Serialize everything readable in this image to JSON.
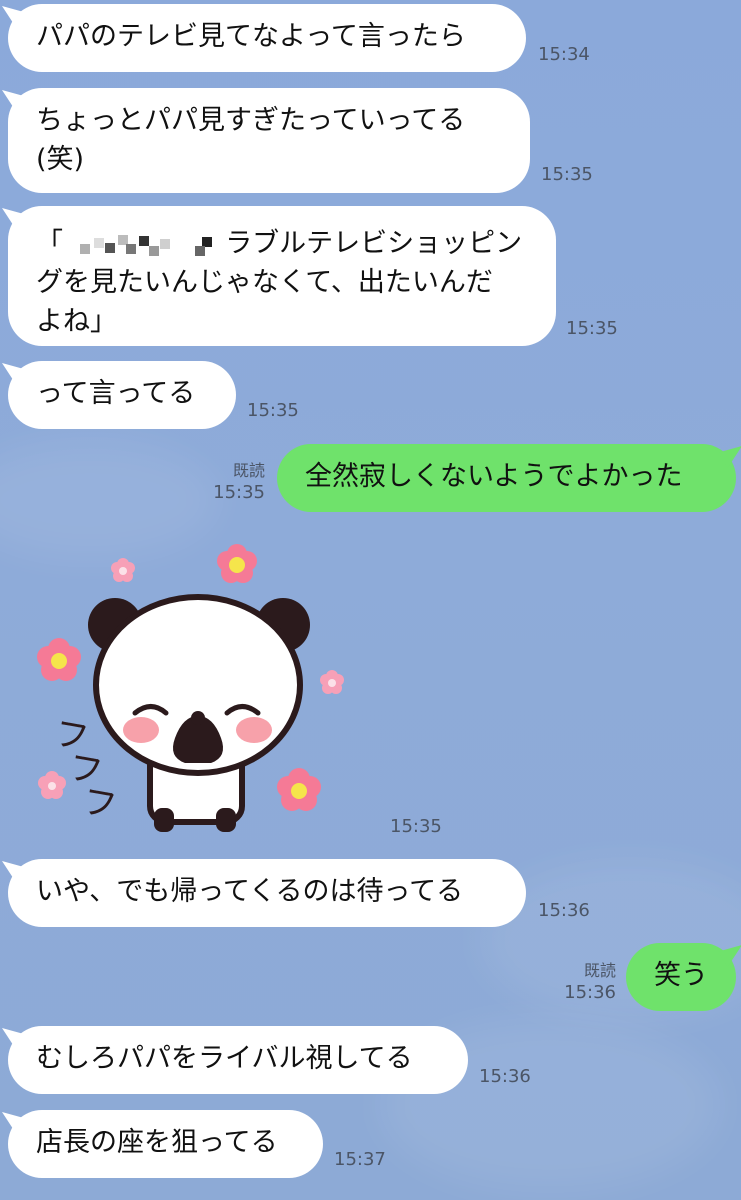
{
  "messages": [
    {
      "text": "パパのテレビ見てなよって言ったら",
      "time": "15:34"
    },
    {
      "text_line1": "ちょっとパパ見すぎたっていってる",
      "text_line2": "(笑)",
      "time": "15:35"
    },
    {
      "text_line1_prefix": "「",
      "text_line1_suffix": "ラブルテレビショッピン",
      "text_line2": "グを見たいんじゃなくて、出たいんだ",
      "text_line3": "よね」",
      "time": "15:35"
    },
    {
      "text": "って言ってる",
      "time": "15:35"
    },
    {
      "text": "全然寂しくないようでよかった",
      "read": "既読",
      "time": "15:35"
    },
    {
      "sticker": "panda-sticker",
      "sticker_text": "フフフ",
      "time": "15:35"
    },
    {
      "text": "いや、でも帰ってくるのは待ってる",
      "time": "15:36"
    },
    {
      "text": "笑う",
      "read": "既読",
      "time": "15:36"
    },
    {
      "text": "むしろパパをライバル視してる",
      "time": "15:36"
    },
    {
      "text": "店長の座を狙ってる",
      "time": "15:37"
    }
  ],
  "colors": {
    "background": "#8caad8",
    "incoming_bubble": "#ffffff",
    "outgoing_bubble": "#6fe26b",
    "meta_text": "#4b5566"
  }
}
